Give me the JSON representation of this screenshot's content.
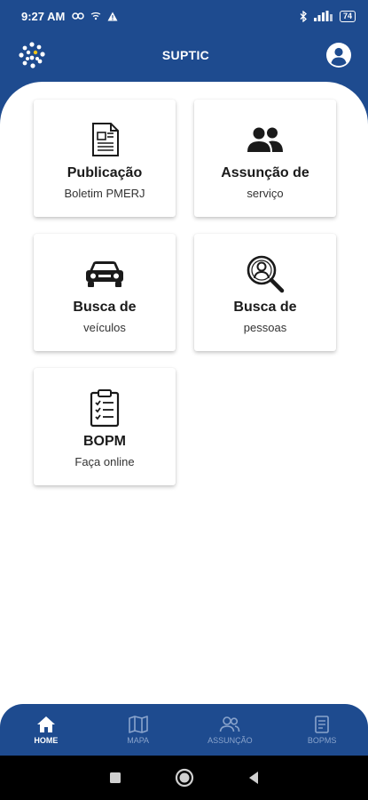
{
  "status_bar": {
    "time": "9:27 AM",
    "battery": "74"
  },
  "header": {
    "title": "SUPTIC",
    "logo_icon": "dots-logo-icon",
    "profile_icon": "account-circle-icon"
  },
  "cards": [
    {
      "title": "Publicação",
      "subtitle": "Boletim PMERJ",
      "icon": "document-icon"
    },
    {
      "title": "Assunção de",
      "subtitle": "serviço",
      "icon": "people-icon"
    },
    {
      "title": "Busca de",
      "subtitle": "veículos",
      "icon": "car-icon"
    },
    {
      "title": "Busca de",
      "subtitle": "pessoas",
      "icon": "person-search-icon"
    },
    {
      "title": "BOPM",
      "subtitle": "Faça online",
      "icon": "clipboard-checklist-icon"
    }
  ],
  "bottom_nav": [
    {
      "label": "HOME",
      "icon": "home-icon",
      "active": true
    },
    {
      "label": "MAPA",
      "icon": "map-icon",
      "active": false
    },
    {
      "label": "ASSUNÇÃO",
      "icon": "people-outline-icon",
      "active": false
    },
    {
      "label": "BOPMS",
      "icon": "doc-outline-icon",
      "active": false
    }
  ],
  "colors": {
    "primary": "#1e4b8f",
    "nav_inactive": "#8aa4cc",
    "logo_accent": "#f0c419"
  }
}
